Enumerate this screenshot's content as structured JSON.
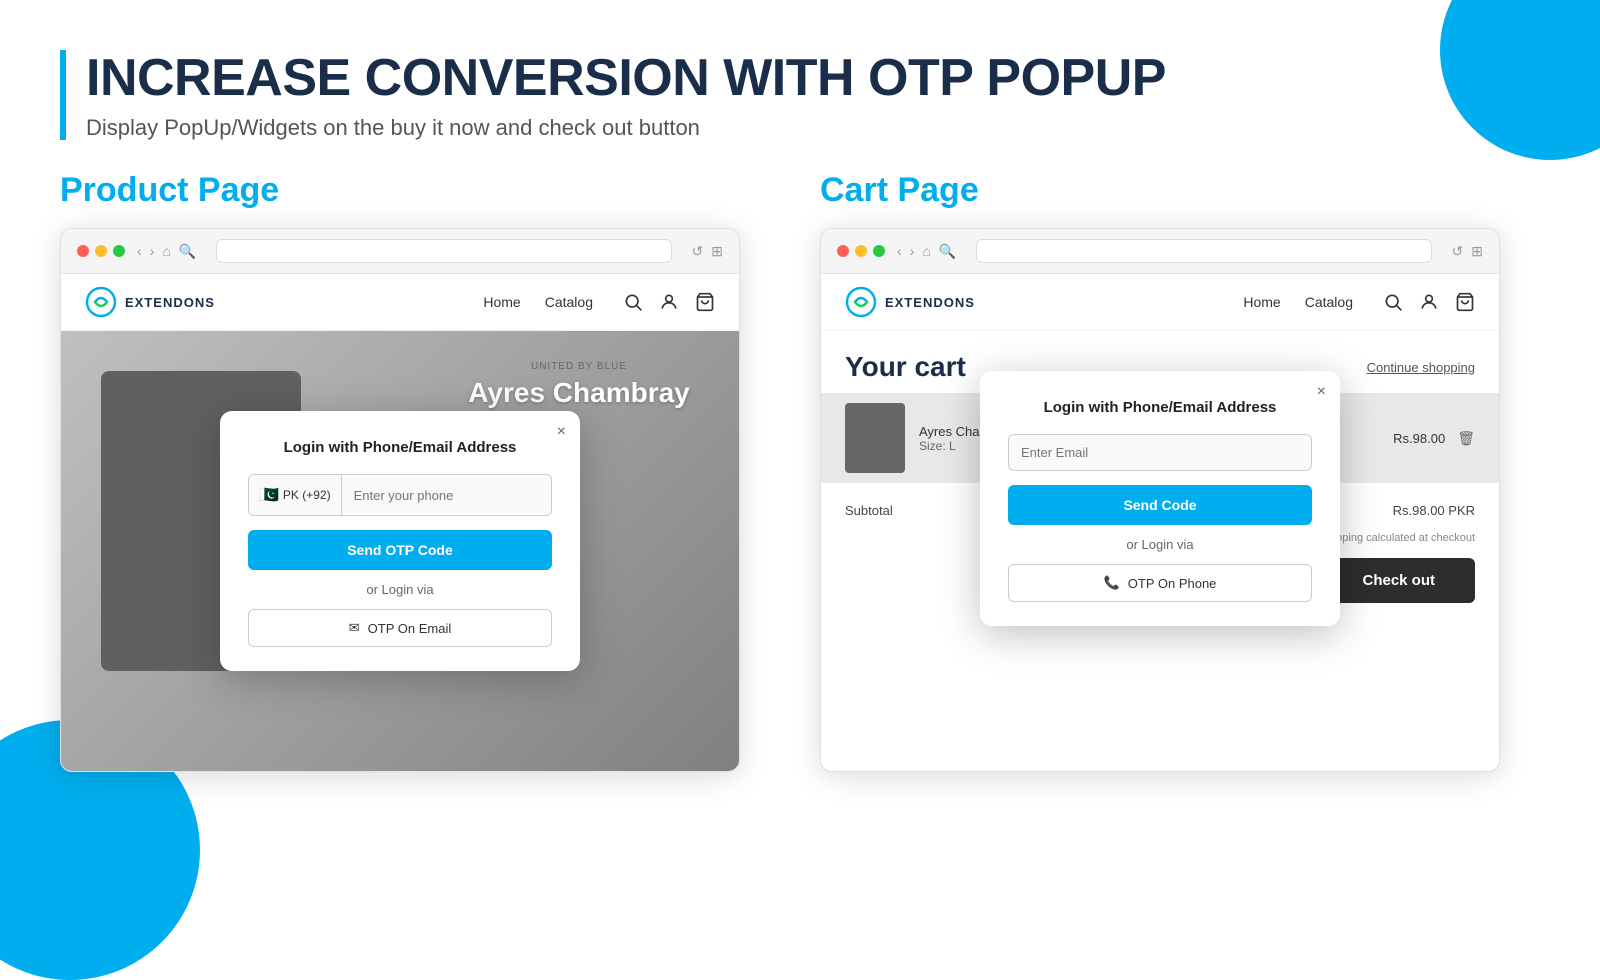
{
  "page": {
    "bg_circle_1": "decorative",
    "bg_circle_2": "decorative"
  },
  "header": {
    "bar": "",
    "title": "INCREASE CONVERSION WITH OTP POPUP",
    "subtitle": "Display PopUp/Widgets on the buy it now and check out button"
  },
  "sections": {
    "product": {
      "label": "Product Page",
      "browser": {
        "dots": [
          "red",
          "yellow",
          "green"
        ],
        "nav_back": "‹",
        "nav_forward": "›",
        "nav_reload": "↺",
        "nav_home": "⌂"
      },
      "store": {
        "logo_text": "EXTENDONS",
        "menu": [
          "Home",
          "Catalog"
        ],
        "icons": [
          "search",
          "user",
          "cart"
        ]
      },
      "product": {
        "brand": "UNITED BY BLUE",
        "title": "Ayres Chambray"
      },
      "popup": {
        "title": "Login with Phone/Email Address",
        "close": "×",
        "flag": "🇵🇰",
        "country_code": "PK (+92)",
        "phone_placeholder": "Enter your phone",
        "send_btn": "Send OTP Code",
        "or_text": "or Login via",
        "alt_btn_icon": "✉",
        "alt_btn_text": "OTP On Email"
      }
    },
    "cart": {
      "label": "Cart Page",
      "browser": {
        "dots": [
          "red",
          "yellow",
          "green"
        ]
      },
      "store": {
        "logo_text": "EXTENDONS",
        "menu": [
          "Home",
          "Catalog"
        ],
        "icons": [
          "search",
          "user",
          "cart"
        ]
      },
      "cart": {
        "title": "Your cart",
        "continue_text": "Continue shopping",
        "item_name": "Ayres Chambr...",
        "item_size": "Size: L",
        "item_price": "Rs.98.00",
        "subtotal_label": "Subtotal",
        "subtotal_value": "Rs.98.00 PKR",
        "shipping_note": "Taxes and shipping calculated at checkout",
        "checkout_btn": "Check out"
      },
      "popup": {
        "title": "Login with Phone/Email Address",
        "close": "×",
        "email_placeholder": "Enter Email",
        "send_btn": "Send Code",
        "or_text": "or Login via",
        "alt_btn_icon": "📞",
        "alt_btn_text": "OTP On Phone"
      }
    }
  }
}
